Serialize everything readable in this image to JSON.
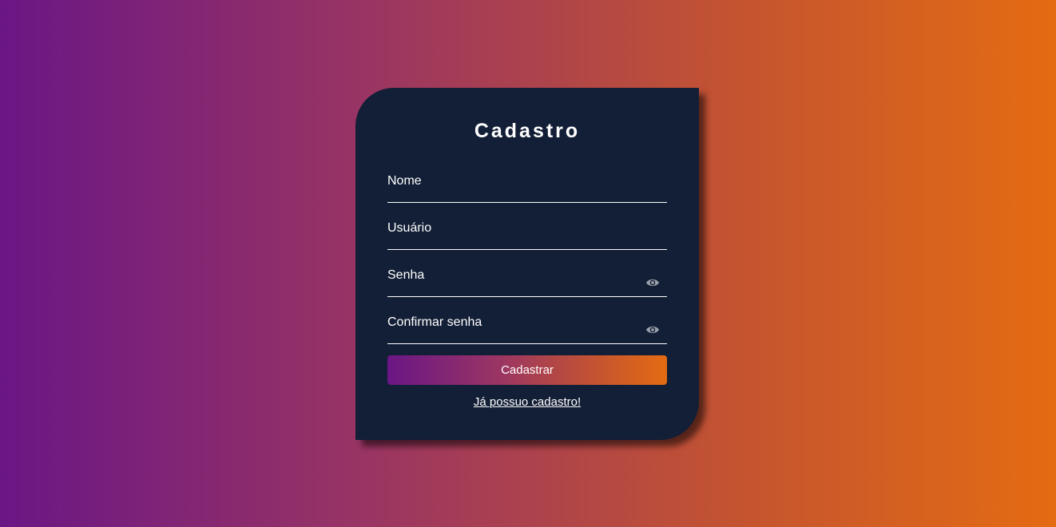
{
  "form": {
    "title": "Cadastro",
    "fields": [
      {
        "label": "Nome",
        "value": ""
      },
      {
        "label": "Usuário",
        "value": ""
      },
      {
        "label": "Senha",
        "value": "",
        "icon": "eye-icon"
      },
      {
        "label": "Confirmar senha",
        "value": "",
        "icon": "eye-icon"
      }
    ],
    "submit_label": "Cadastrar",
    "login_link": "Já possuo cadastro!"
  },
  "colors": {
    "card_background": "#131f36",
    "gradient_start": "#6a1685",
    "gradient_end": "#e46b12",
    "text": "#ffffff",
    "icon": "#9aa0ab"
  }
}
